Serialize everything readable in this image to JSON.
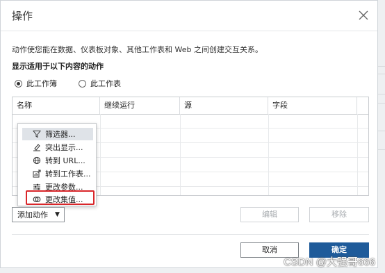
{
  "dialog": {
    "title": "操作",
    "description": "动作使您能在数据、仪表板对象、其他工作表和 Web 之间创建交互关系。",
    "subtitle": "显示适用于以下内容的动作",
    "radio": [
      {
        "label": "此工作簿",
        "selected": true
      },
      {
        "label": "此工作表",
        "selected": false
      }
    ]
  },
  "table": {
    "columns": [
      "名称",
      "继续运行",
      "源",
      "字段"
    ]
  },
  "menu": {
    "items": [
      {
        "label": "筛选器...",
        "icon": "filter-icon"
      },
      {
        "label": "突出显示...",
        "icon": "highlight-pen-icon"
      },
      {
        "label": "转到 URL...",
        "icon": "globe-icon"
      },
      {
        "label": "转到工作表...",
        "icon": "sheet-navigate-icon"
      },
      {
        "label": "更改参数...",
        "icon": "sliders-icon"
      },
      {
        "label": "更改集值...",
        "icon": "set-venn-icon"
      }
    ]
  },
  "buttons": {
    "add_action": "添加动作",
    "edit": "编辑",
    "remove": "移除",
    "cancel": "取消",
    "ok": "确定"
  },
  "watermark": "CSDN @大强哥666",
  "colors": {
    "primary": "#1f5b9a",
    "highlight_box": "#d9262a"
  }
}
